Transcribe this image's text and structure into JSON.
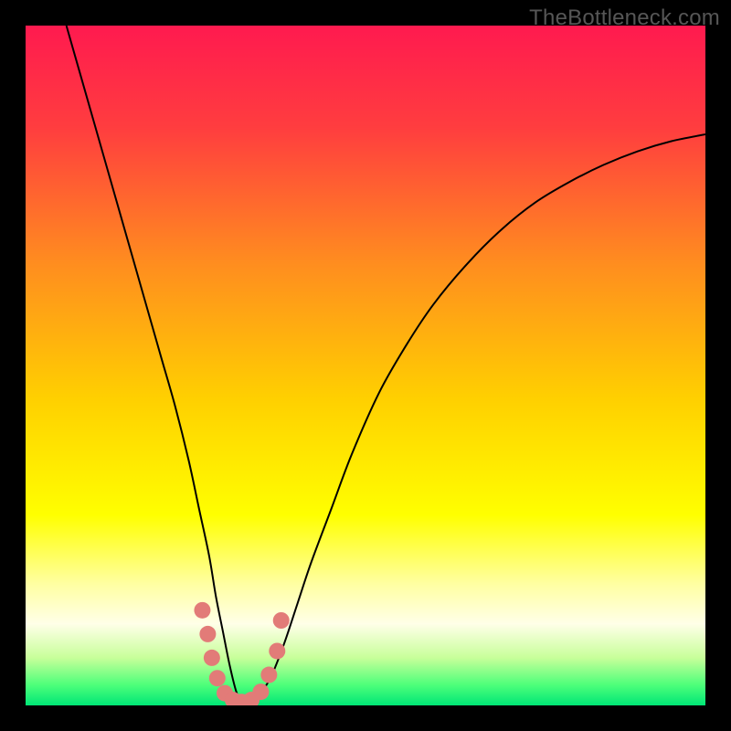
{
  "watermark": "TheBottleneck.com",
  "chart_data": {
    "type": "line",
    "title": "",
    "xlabel": "",
    "ylabel": "",
    "xlim": [
      0,
      100
    ],
    "ylim": [
      0,
      100
    ],
    "background_gradient": {
      "stops": [
        {
          "pos": 0.0,
          "color": "#ff1a4f"
        },
        {
          "pos": 0.15,
          "color": "#ff3d3f"
        },
        {
          "pos": 0.35,
          "color": "#ff8d1f"
        },
        {
          "pos": 0.55,
          "color": "#ffd000"
        },
        {
          "pos": 0.72,
          "color": "#ffff00"
        },
        {
          "pos": 0.82,
          "color": "#ffffa0"
        },
        {
          "pos": 0.88,
          "color": "#ffffe8"
        },
        {
          "pos": 0.93,
          "color": "#c8ff9a"
        },
        {
          "pos": 0.97,
          "color": "#4dff7a"
        },
        {
          "pos": 1.0,
          "color": "#00e676"
        }
      ]
    },
    "series": [
      {
        "name": "bottleneck-curve",
        "color": "#000000",
        "width": 2,
        "x": [
          6,
          8,
          10,
          12,
          14,
          16,
          18,
          20,
          22,
          24,
          25.5,
          27,
          28,
          29,
          30,
          31,
          32,
          33,
          34,
          36,
          38,
          40,
          42,
          45,
          48,
          52,
          56,
          60,
          65,
          70,
          75,
          80,
          85,
          90,
          95,
          100
        ],
        "y": [
          100,
          93,
          86,
          79,
          72,
          65,
          58,
          51,
          44,
          36,
          29,
          22,
          16,
          11,
          6,
          2,
          0,
          0,
          1,
          4,
          9,
          15,
          21,
          29,
          37,
          46,
          53,
          59,
          65,
          70,
          74,
          77,
          79.5,
          81.5,
          83,
          84
        ]
      }
    ],
    "markers": {
      "name": "sweet-spot-dots",
      "color": "#e27b78",
      "radius": 9,
      "points": [
        {
          "x": 26.0,
          "y": 14.0
        },
        {
          "x": 26.8,
          "y": 10.5
        },
        {
          "x": 27.4,
          "y": 7.0
        },
        {
          "x": 28.2,
          "y": 4.0
        },
        {
          "x": 29.3,
          "y": 1.8
        },
        {
          "x": 30.5,
          "y": 0.8
        },
        {
          "x": 31.8,
          "y": 0.5
        },
        {
          "x": 33.2,
          "y": 0.8
        },
        {
          "x": 34.6,
          "y": 2.0
        },
        {
          "x": 35.8,
          "y": 4.5
        },
        {
          "x": 37.0,
          "y": 8.0
        },
        {
          "x": 37.6,
          "y": 12.5
        }
      ]
    }
  }
}
